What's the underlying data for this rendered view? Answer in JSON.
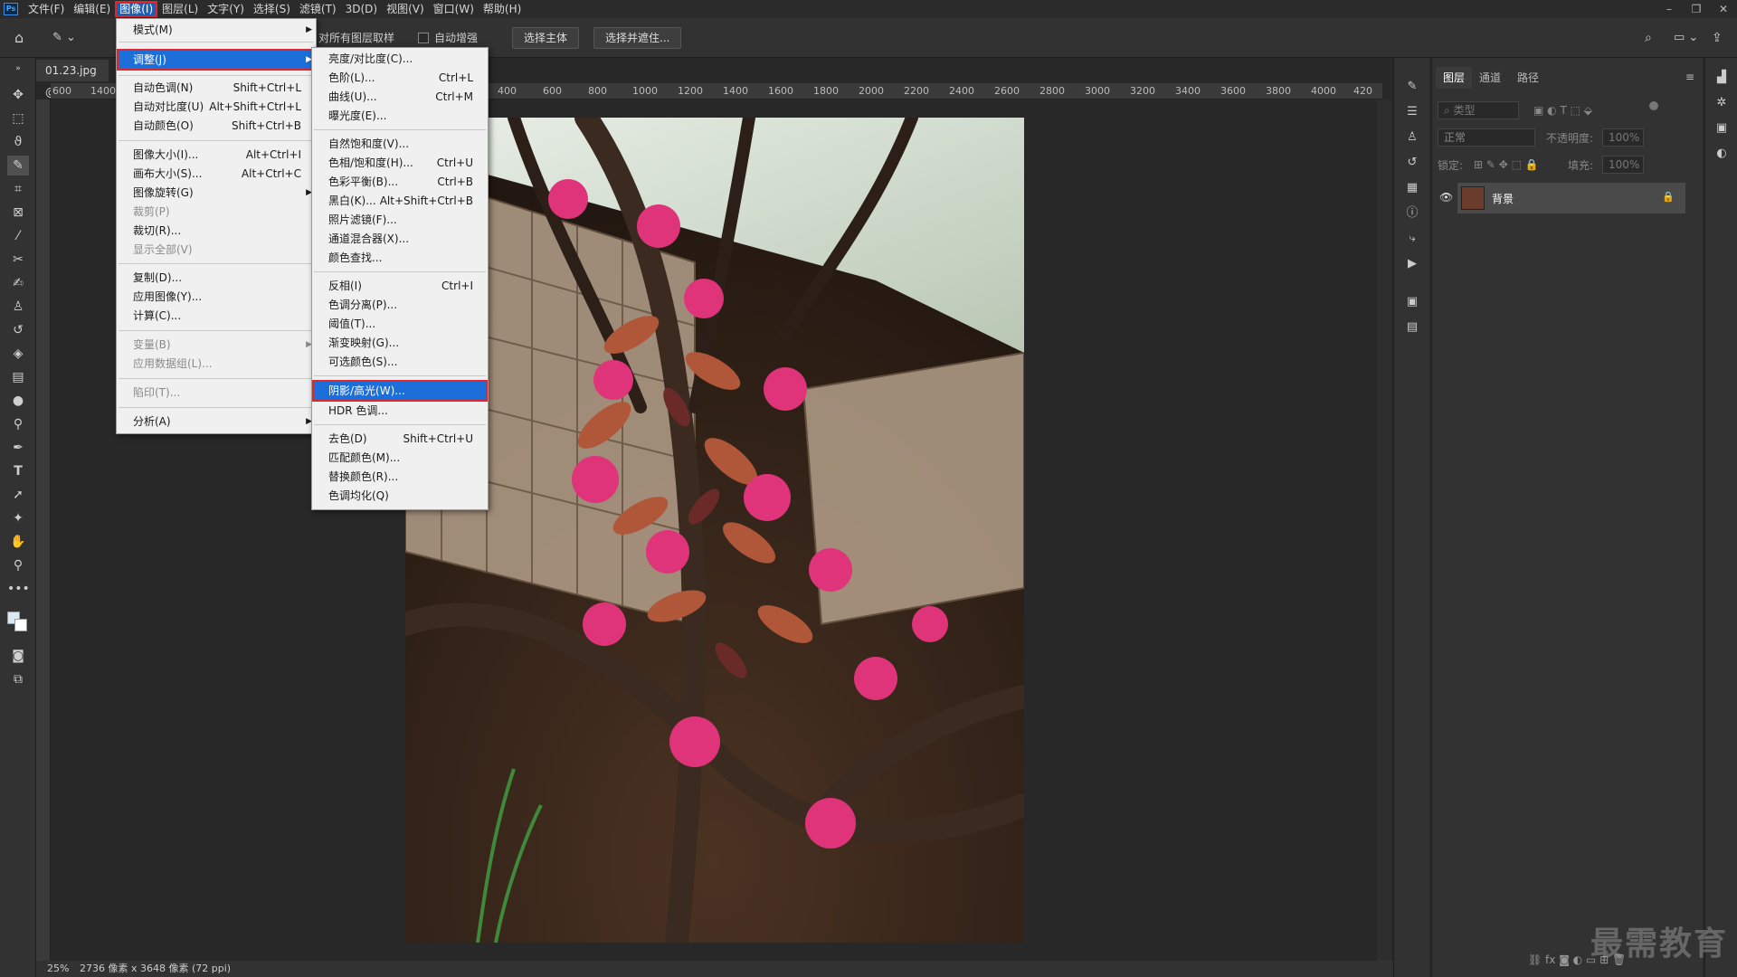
{
  "menubar": {
    "items": [
      "文件(F)",
      "编辑(E)",
      "图像(I)",
      "图层(L)",
      "文字(Y)",
      "选择(S)",
      "滤镜(T)",
      "3D(D)",
      "视图(V)",
      "窗口(W)",
      "帮助(H)"
    ],
    "active_index": 2
  },
  "options_bar": {
    "sample_all_label": "对所有图层取样",
    "auto_enhance_label": "自动增强",
    "select_subject": "选择主体",
    "select_mask": "选择并遮住..."
  },
  "document": {
    "tab_title": "01.23.jpg @ 2",
    "zoom": "25%",
    "info": "2736 像素 x 3648 像素 (72 ppi)"
  },
  "ruler_h": [
    "600",
    "1400",
    "400",
    "600",
    "800",
    "1000",
    "1200",
    "1400",
    "1600",
    "1800",
    "2000",
    "2200",
    "2400",
    "2600",
    "2800",
    "3000",
    "3200",
    "3400",
    "3600",
    "3800",
    "4000",
    "420"
  ],
  "image_menu": {
    "items": [
      {
        "label": "模式(M)",
        "shortcut": "",
        "submenu": true,
        "disabled": false
      },
      {
        "label": "调整(J)",
        "shortcut": "",
        "submenu": true,
        "disabled": false,
        "highlighted": true
      },
      {
        "label": "自动色调(N)",
        "shortcut": "Shift+Ctrl+L"
      },
      {
        "label": "自动对比度(U)",
        "shortcut": "Alt+Shift+Ctrl+L"
      },
      {
        "label": "自动颜色(O)",
        "shortcut": "Shift+Ctrl+B"
      },
      {
        "label": "图像大小(I)...",
        "shortcut": "Alt+Ctrl+I"
      },
      {
        "label": "画布大小(S)...",
        "shortcut": "Alt+Ctrl+C"
      },
      {
        "label": "图像旋转(G)",
        "shortcut": "",
        "submenu": true
      },
      {
        "label": "裁剪(P)",
        "disabled": true
      },
      {
        "label": "裁切(R)..."
      },
      {
        "label": "显示全部(V)",
        "disabled": true
      },
      {
        "label": "复制(D)..."
      },
      {
        "label": "应用图像(Y)..."
      },
      {
        "label": "计算(C)..."
      },
      {
        "label": "变量(B)",
        "submenu": true,
        "disabled": true
      },
      {
        "label": "应用数据组(L)...",
        "disabled": true
      },
      {
        "label": "陷印(T)...",
        "disabled": true
      },
      {
        "label": "分析(A)",
        "submenu": true
      }
    ]
  },
  "adjust_menu": {
    "items": [
      {
        "label": "亮度/对比度(C)...",
        "shortcut": ""
      },
      {
        "label": "色阶(L)...",
        "shortcut": "Ctrl+L"
      },
      {
        "label": "曲线(U)...",
        "shortcut": "Ctrl+M"
      },
      {
        "label": "曝光度(E)...",
        "shortcut": ""
      },
      {
        "label": "自然饱和度(V)...",
        "shortcut": ""
      },
      {
        "label": "色相/饱和度(H)...",
        "shortcut": "Ctrl+U"
      },
      {
        "label": "色彩平衡(B)...",
        "shortcut": "Ctrl+B"
      },
      {
        "label": "黑白(K)...",
        "shortcut": "Alt+Shift+Ctrl+B"
      },
      {
        "label": "照片滤镜(F)...",
        "shortcut": ""
      },
      {
        "label": "通道混合器(X)...",
        "shortcut": ""
      },
      {
        "label": "颜色查找...",
        "shortcut": ""
      },
      {
        "label": "反相(I)",
        "shortcut": "Ctrl+I"
      },
      {
        "label": "色调分离(P)...",
        "shortcut": ""
      },
      {
        "label": "阈值(T)...",
        "shortcut": ""
      },
      {
        "label": "渐变映射(G)...",
        "shortcut": ""
      },
      {
        "label": "可选颜色(S)...",
        "shortcut": ""
      },
      {
        "label": "阴影/高光(W)...",
        "shortcut": "",
        "highlighted": true
      },
      {
        "label": "HDR 色调...",
        "shortcut": ""
      },
      {
        "label": "去色(D)",
        "shortcut": "Shift+Ctrl+U"
      },
      {
        "label": "匹配颜色(M)...",
        "shortcut": ""
      },
      {
        "label": "替换颜色(R)...",
        "shortcut": ""
      },
      {
        "label": "色调均化(Q)",
        "shortcut": ""
      }
    ]
  },
  "layers_panel": {
    "tabs": [
      "图层",
      "通道",
      "路径"
    ],
    "filter_placeholder": "类型",
    "blend_mode": "正常",
    "opacity_label": "不透明度:",
    "opacity_value": "100%",
    "lock_label": "锁定:",
    "fill_label": "填充:",
    "fill_value": "100%",
    "layer_name": "背景"
  },
  "watermark": "最需教育"
}
